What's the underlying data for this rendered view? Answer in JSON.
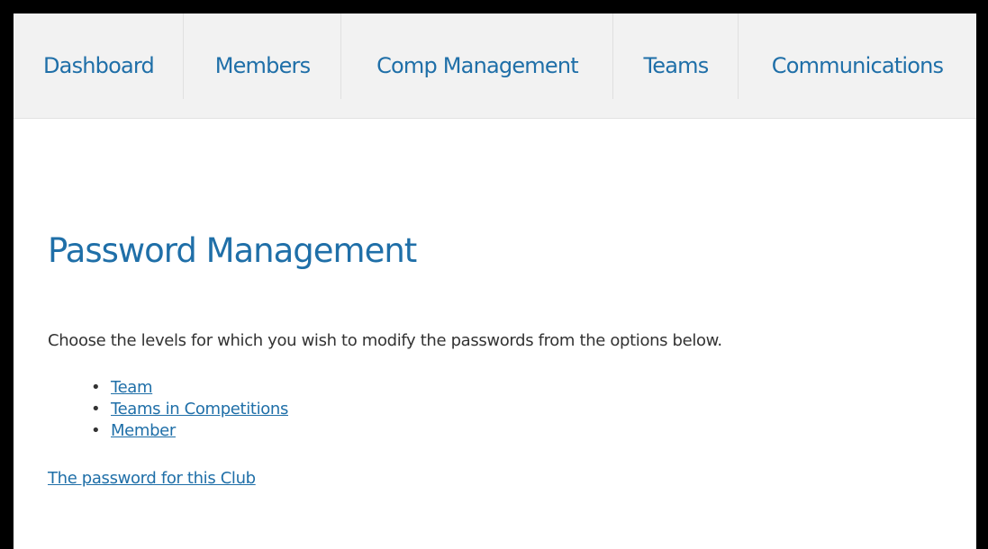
{
  "nav": {
    "items": [
      {
        "label": "Dashboard"
      },
      {
        "label": "Members"
      },
      {
        "label": "Comp Management"
      },
      {
        "label": "Teams"
      },
      {
        "label": "Communications"
      }
    ]
  },
  "main": {
    "title": "Password Management",
    "intro": "Choose the levels for which you wish to modify the passwords from the options below.",
    "options": [
      {
        "label": "Team"
      },
      {
        "label": "Teams in Competitions"
      },
      {
        "label": "Member"
      }
    ],
    "club_link": "The password for this Club"
  },
  "colors": {
    "accent": "#1f6fa8",
    "nav_background": "#f2f2f2",
    "body_text": "#333333",
    "frame_border": "#000000"
  }
}
